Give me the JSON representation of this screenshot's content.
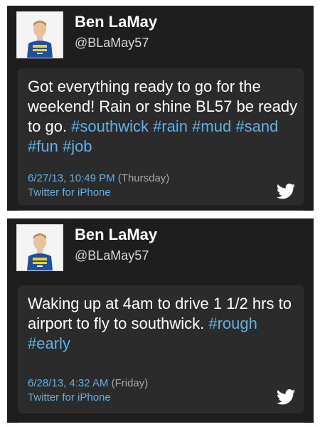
{
  "tweets": [
    {
      "name": "Ben LaMay",
      "handle": "@BLaMay57",
      "text_parts": [
        {
          "text": "Got everything ready to go for the weekend! Rain or shine BL57 be ready to go. ",
          "tag": false
        },
        {
          "text": "#southwick",
          "tag": true
        },
        {
          "text": " ",
          "tag": false
        },
        {
          "text": "#rain",
          "tag": true
        },
        {
          "text": " ",
          "tag": false
        },
        {
          "text": "#mud",
          "tag": true
        },
        {
          "text": " ",
          "tag": false
        },
        {
          "text": "#sand",
          "tag": true
        },
        {
          "text": " ",
          "tag": false
        },
        {
          "text": "#fun",
          "tag": true
        },
        {
          "text": " ",
          "tag": false
        },
        {
          "text": "#job",
          "tag": true
        }
      ],
      "date": "6/27/13, 10:49 PM",
      "day": " (Thursday)",
      "source": "Twitter for iPhone"
    },
    {
      "name": "Ben LaMay",
      "handle": "@BLaMay57",
      "text_parts": [
        {
          "text": "Waking up at 4am to drive 1 1/2 hrs to airport to fly to southwick. ",
          "tag": false
        },
        {
          "text": "#rough",
          "tag": true
        },
        {
          "text": " ",
          "tag": false
        },
        {
          "text": "#early",
          "tag": true
        }
      ],
      "date": "6/28/13, 4:32 AM",
      "day": " (Friday)",
      "source": "Twitter for iPhone"
    }
  ],
  "icons": {
    "bird": "twitter-bird-icon"
  },
  "colors": {
    "panel_bg": "#1e1e1e",
    "card_bg": "#2b2b2b",
    "link": "#5fb1e8",
    "muted": "#a8a8a8"
  }
}
